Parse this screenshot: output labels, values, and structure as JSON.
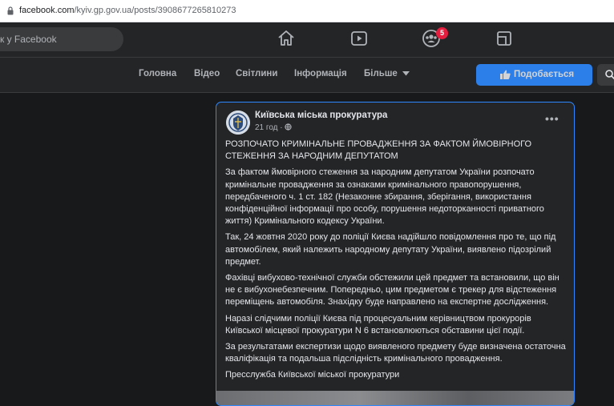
{
  "browser": {
    "url_domain": "facebook.com",
    "url_path": "/kyiv.gp.gov.ua/posts/3908677265810273"
  },
  "topnav": {
    "search_placeholder": "к у Facebook",
    "notifications_badge": "5",
    "icons": [
      "home-icon",
      "watch-icon",
      "groups-icon",
      "gaming-icon"
    ]
  },
  "pagenav": {
    "tabs": [
      "Головна",
      "Відео",
      "Світлини",
      "Інформація",
      "Більше"
    ],
    "like_button": "Подобається"
  },
  "post": {
    "page_name": "Київська міська прокуратура",
    "time": "21 год",
    "paragraphs": [
      "РОЗПОЧАТО КРИМІНАЛЬНЕ ПРОВАДЖЕННЯ ЗА ФАКТОМ ЙМОВІРНОГО СТЕЖЕННЯ ЗА НАРОДНИМ ДЕПУТАТОМ",
      "За фактом ймовірного стеження за народним депутатом України розпочато кримінальне провадження за ознаками кримінального правопорушення, передбаченого ч. 1 ст. 182 (Незаконне збирання, зберігання, використання конфіденційної інформації про особу, порушення недоторканності приватного життя) Кримінального кодексу України.",
      "Так, 24 жовтня 2020 року до поліції Києва надійшло повідомлення про те, що під автомобілем, який належить народному депутату України, виявлено підозрілий предмет.",
      "Фахівці вибухово-технічної служби обстежили цей предмет та встановили, що він не є вибухонебезпечним. Попередньо, цим предметом є трекер для відстеження переміщень автомобіля. Знахідку буде направлено на експертне дослідження.",
      "Наразі слідчими поліції Києва під процесуальним керівництвом прокурорів Київської місцевої прокуратури N 6 встановлюються обставини цієї події.",
      "За результатами експертизи щодо виявленого предмету буде визначена остаточна кваліфікація та подальша підслідність кримінального провадження.",
      "Пресслужба Київської міської прокуратури"
    ]
  }
}
